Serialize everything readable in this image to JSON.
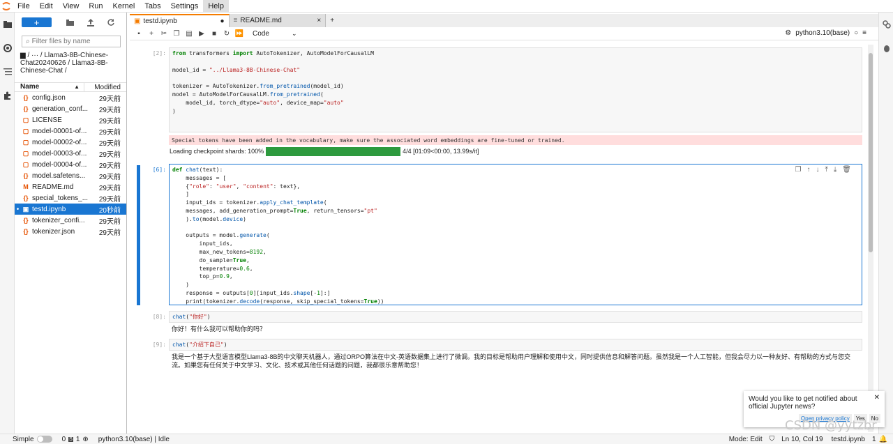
{
  "menu": {
    "items": [
      "File",
      "Edit",
      "View",
      "Run",
      "Kernel",
      "Tabs",
      "Settings",
      "Help"
    ]
  },
  "filebrowser": {
    "new_label": "+",
    "filter_placeholder": "Filter files by name",
    "breadcrumb": "/ ··· / Llama3-8B-Chinese-Chat20240626 / Llama3-8B-Chinese-Chat /",
    "col_name": "Name",
    "col_modified": "Modified",
    "files": [
      {
        "name": "config.json",
        "modified": "29天前",
        "icon": "{}",
        "dot": ""
      },
      {
        "name": "generation_conf...",
        "modified": "29天前",
        "icon": "{}",
        "dot": ""
      },
      {
        "name": "LICENSE",
        "modified": "29天前",
        "icon": "▢",
        "dot": ""
      },
      {
        "name": "model-00001-of...",
        "modified": "29天前",
        "icon": "▢",
        "dot": ""
      },
      {
        "name": "model-00002-of...",
        "modified": "29天前",
        "icon": "▢",
        "dot": ""
      },
      {
        "name": "model-00003-of...",
        "modified": "29天前",
        "icon": "▢",
        "dot": ""
      },
      {
        "name": "model-00004-of...",
        "modified": "29天前",
        "icon": "▢",
        "dot": ""
      },
      {
        "name": "model.safetens...",
        "modified": "29天前",
        "icon": "{}",
        "dot": ""
      },
      {
        "name": "README.md",
        "modified": "29天前",
        "icon": "M",
        "dot": ""
      },
      {
        "name": "special_tokens_...",
        "modified": "29天前",
        "icon": "{}",
        "dot": ""
      },
      {
        "name": "testd.ipynb",
        "modified": "20秒前",
        "icon": "▣",
        "dot": "•"
      },
      {
        "name": "tokenizer_confi...",
        "modified": "29天前",
        "icon": "{}",
        "dot": ""
      },
      {
        "name": "tokenizer.json",
        "modified": "29天前",
        "icon": "{}",
        "dot": ""
      }
    ]
  },
  "tabs": [
    {
      "label": "testd.ipynb",
      "marker": "●"
    },
    {
      "label": "README.md",
      "marker": "×"
    }
  ],
  "toolbar": {
    "cell_type": "Code",
    "kernel_name": "python3.10(base)"
  },
  "cells": {
    "c1_prompt": "[2]:",
    "c2_prompt": "[6]:",
    "c3_prompt": "[8]:",
    "c4_prompt": "[9]:",
    "stderr": "Special tokens have been added in the vocabulary, make sure the associated word embeddings are fine-tuned or trained.",
    "progress_label": "Loading checkpoint shards: 100%",
    "progress_value": 1.0,
    "progress_stats": "4/4 [01:09<00:00, 13.99s/it]",
    "c3_output": "你好！有什么我可以帮助你的吗？",
    "c4_output": "我是一个基于大型语言模型Llama3-8B的中文聊天机器人，通过ORPO算法在中文-英语数据集上进行了微调。我的目标是帮助用户理解和使用中文，同时提供信息和解答问题。虽然我是一个人工智能，但我会尽力以一种友好、有帮助的方式与您交流。如果您有任何关于中文学习、文化、技术或其他任何话题的问题，我都很乐意帮助您！"
  },
  "notification": {
    "text": "Would you like to get notified about official Jupyter news?",
    "link": "Open privacy policy",
    "yes": "Yes",
    "no": "No"
  },
  "status": {
    "simple": "Simple",
    "count0": "0",
    "count1": "1",
    "kernel": "python3.10(base) | Idle",
    "mode": "Mode: Edit",
    "position": "Ln 10, Col 19",
    "file": "testd.ipynb",
    "num": "1"
  },
  "watermark": "CSDN @yytzbr"
}
